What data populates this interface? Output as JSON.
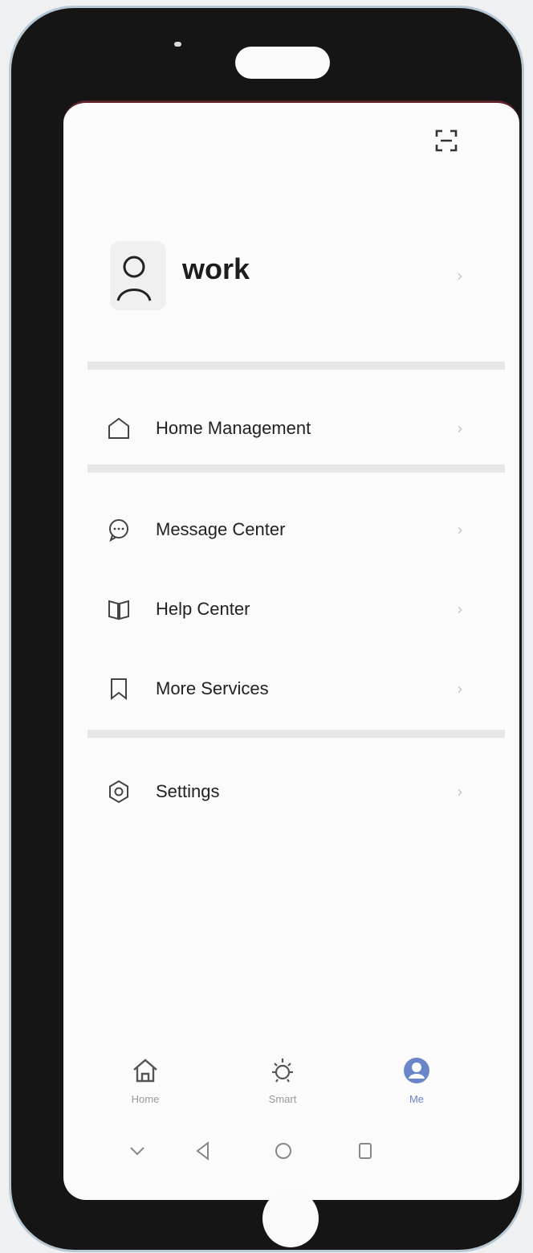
{
  "profile": {
    "name": "work"
  },
  "menu": {
    "items": [
      {
        "label": "Home Management"
      },
      {
        "label": "Message Center"
      },
      {
        "label": "Help Center"
      },
      {
        "label": "More Services"
      },
      {
        "label": "Settings"
      }
    ]
  },
  "tabbar": {
    "tabs": [
      {
        "label": "Home",
        "icon": "home-icon"
      },
      {
        "label": "Smart",
        "icon": "sun-icon"
      },
      {
        "label": "Me",
        "icon": "profile-icon",
        "active": true
      }
    ]
  },
  "colors": {
    "accent": "#6a86c9",
    "frame": "#151515"
  }
}
